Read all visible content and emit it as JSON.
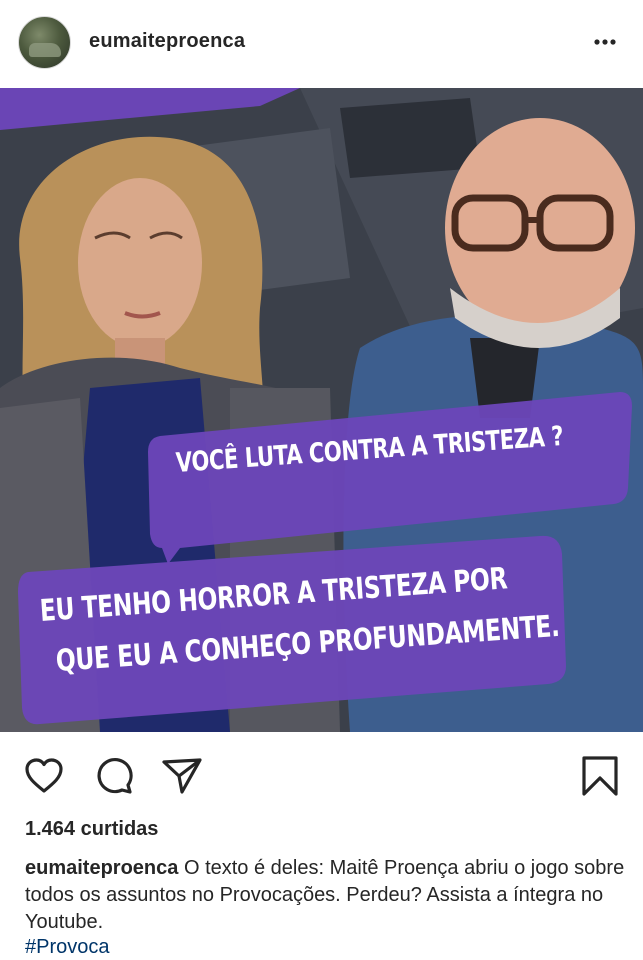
{
  "post": {
    "username": "eumaiteproenca",
    "question_bubble": "Você luta contra a tristeza ?",
    "answer_line1": "Eu tenho horror a tristeza por",
    "answer_line2": "que eu a conheço profundamente."
  },
  "likes": "1.464 curtidas",
  "caption": {
    "username": "eumaiteproenca",
    "text": "O texto é deles: Maitê Proença abriu o jogo sobre todos os assuntos no Provocações. Perdeu? Assista a íntegra no Youtube.",
    "hashtag": "#Provoca"
  },
  "colors": {
    "bubble_purple": "#6b46b8",
    "background": "#ffffff",
    "text": "#262626"
  },
  "icons": [
    "more-options-icon",
    "heart-icon",
    "comment-icon",
    "share-icon",
    "bookmark-icon"
  ]
}
